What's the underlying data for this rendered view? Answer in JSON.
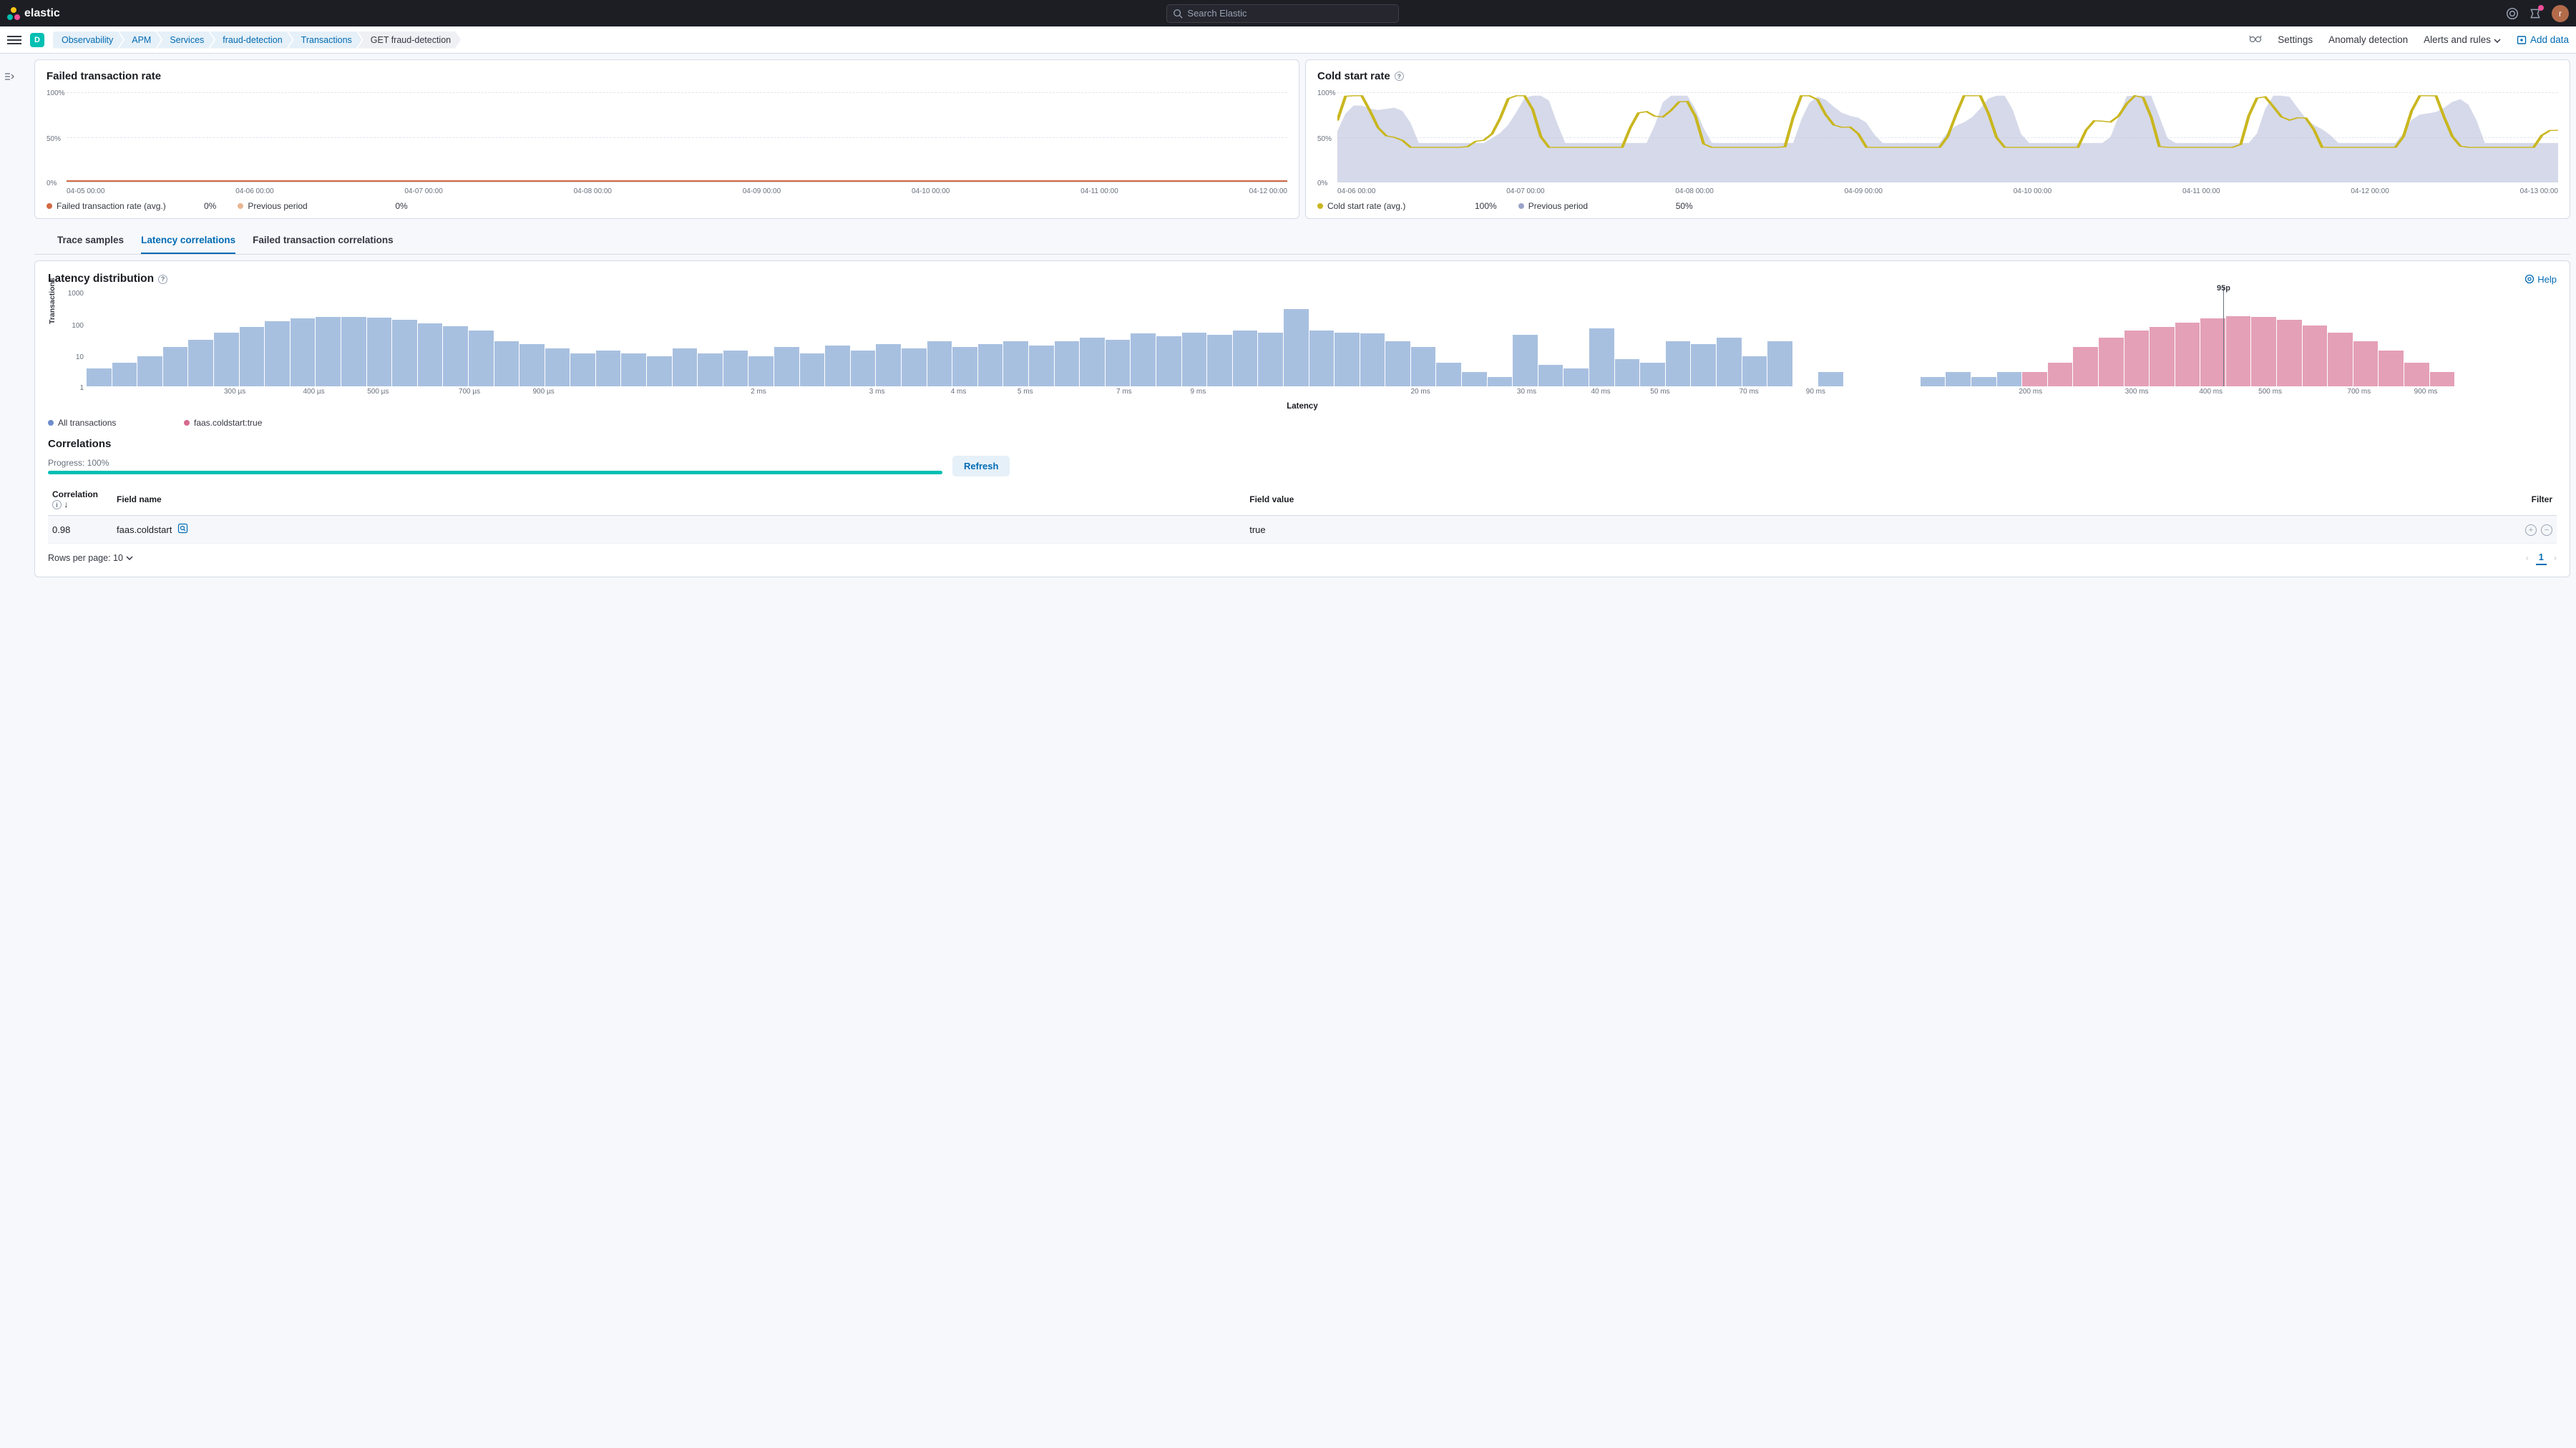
{
  "brand": "elastic",
  "search_placeholder": "Search Elastic",
  "space_letter": "D",
  "avatar_letter": "r",
  "breadcrumbs": [
    "Observability",
    "APM",
    "Services",
    "fraud-detection",
    "Transactions",
    "GET fraud-detection"
  ],
  "header_links": {
    "settings": "Settings",
    "anomaly": "Anomaly detection",
    "alerts": "Alerts and rules",
    "add": "Add data"
  },
  "panel_failed": {
    "title": "Failed transaction rate",
    "legend": [
      {
        "label": "Failed transaction rate (avg.)",
        "value": "0%",
        "color": "#d36a43"
      },
      {
        "label": "Previous period",
        "value": "0%",
        "color": "#e9b692"
      }
    ],
    "yticks": [
      "100%",
      "50%",
      "0%"
    ],
    "xticks": [
      "04-05 00:00",
      "04-06 00:00",
      "04-07 00:00",
      "04-08 00:00",
      "04-09 00:00",
      "04-10 00:00",
      "04-11 00:00",
      "04-12 00:00"
    ]
  },
  "panel_cold": {
    "title": "Cold start rate",
    "legend": [
      {
        "label": "Cold start rate (avg.)",
        "value": "100%",
        "color": "#c9b61f"
      },
      {
        "label": "Previous period",
        "value": "50%",
        "color": "#9aa3c9"
      }
    ],
    "yticks": [
      "100%",
      "50%",
      "0%"
    ],
    "xticks": [
      "04-06 00:00",
      "04-07 00:00",
      "04-08 00:00",
      "04-09 00:00",
      "04-10 00:00",
      "04-11 00:00",
      "04-12 00:00",
      "04-13 00:00"
    ]
  },
  "tabs": [
    "Trace samples",
    "Latency correlations",
    "Failed transaction correlations"
  ],
  "active_tab": 1,
  "latency": {
    "title": "Latency distribution",
    "help": "Help",
    "ylabel": "Transactions",
    "xlabel": "Latency",
    "ylabs": [
      "1000",
      "100",
      "10",
      "1"
    ],
    "p95_label": "95p",
    "p95_pos": 86.5,
    "xticks": [
      {
        "l": "300 µs",
        "p": 6
      },
      {
        "l": "400 µs",
        "p": 9.2
      },
      {
        "l": "500 µs",
        "p": 11.8
      },
      {
        "l": "700 µs",
        "p": 15.5
      },
      {
        "l": "900 µs",
        "p": 18.5
      },
      {
        "l": "2 ms",
        "p": 27.2
      },
      {
        "l": "3 ms",
        "p": 32
      },
      {
        "l": "4 ms",
        "p": 35.3
      },
      {
        "l": "5 ms",
        "p": 38
      },
      {
        "l": "7 ms",
        "p": 42
      },
      {
        "l": "9 ms",
        "p": 45
      },
      {
        "l": "20 ms",
        "p": 54
      },
      {
        "l": "30 ms",
        "p": 58.3
      },
      {
        "l": "40 ms",
        "p": 61.3
      },
      {
        "l": "50 ms",
        "p": 63.7
      },
      {
        "l": "70 ms",
        "p": 67.3
      },
      {
        "l": "90 ms",
        "p": 70
      },
      {
        "l": "200 ms",
        "p": 78.7
      },
      {
        "l": "300 ms",
        "p": 83
      },
      {
        "l": "400 ms",
        "p": 86
      },
      {
        "l": "500 ms",
        "p": 88.4
      },
      {
        "l": "700 ms",
        "p": 92
      },
      {
        "l": "900 ms",
        "p": 94.7
      }
    ],
    "legend": [
      {
        "label": "All transactions",
        "color": "#6d8cde"
      },
      {
        "label": "faas.coldstart:true",
        "color": "#d66a8d"
      }
    ]
  },
  "correlations": {
    "title": "Correlations",
    "progress_label": "Progress: 100%",
    "refresh": "Refresh",
    "cols": {
      "corr": "Correlation",
      "field": "Field name",
      "val": "Field value",
      "filter": "Filter"
    },
    "rows": [
      {
        "corr": "0.98",
        "field": "faas.coldstart",
        "value": "true"
      }
    ],
    "rows_per_page": "Rows per page: 10",
    "page": "1"
  },
  "chart_data": [
    {
      "type": "line",
      "title": "Failed transaction rate",
      "ylim": [
        0,
        100
      ],
      "x": [
        "04-05",
        "04-06",
        "04-07",
        "04-08",
        "04-09",
        "04-10",
        "04-11",
        "04-12"
      ],
      "series": [
        {
          "name": "Failed transaction rate (avg.)",
          "values": [
            0,
            0,
            0,
            0,
            0,
            0,
            0,
            0
          ]
        },
        {
          "name": "Previous period",
          "values": [
            0,
            0,
            0,
            0,
            0,
            0,
            0,
            0
          ]
        }
      ]
    },
    {
      "type": "area",
      "title": "Cold start rate",
      "ylim": [
        0,
        100
      ],
      "x": [
        "04-06",
        "04-07",
        "04-08",
        "04-09",
        "04-10",
        "04-11",
        "04-12",
        "04-13"
      ],
      "series": [
        {
          "name": "Cold start rate (avg.)",
          "note": "oscillating approx 20–100"
        },
        {
          "name": "Previous period",
          "note": "oscillating approx 10–100"
        }
      ]
    },
    {
      "type": "bar",
      "title": "Latency distribution",
      "ylabel": "Transactions",
      "xlabel": "Latency",
      "yscale": "log",
      "ylim": [
        1,
        1000
      ],
      "annotation": "95p",
      "series": [
        {
          "name": "All transactions",
          "values": [
            4,
            6,
            10,
            20,
            35,
            60,
            90,
            140,
            180,
            200,
            200,
            190,
            160,
            120,
            95,
            70,
            30,
            25,
            18,
            12,
            15,
            12,
            10,
            18,
            12,
            15,
            10,
            20,
            12,
            22,
            15,
            25,
            18,
            30,
            20,
            25,
            30,
            22,
            30,
            40,
            35,
            55,
            45,
            60,
            50,
            70,
            60,
            350,
            70,
            60,
            55,
            30,
            20,
            6,
            3,
            2,
            50,
            5,
            4,
            80,
            8,
            6,
            30,
            25,
            40,
            10,
            30,
            0,
            3,
            0,
            0,
            0,
            2,
            3,
            2,
            3
          ]
        },
        {
          "name": "faas.coldstart:true",
          "values_offset": 76,
          "values": [
            3,
            6,
            20,
            40,
            70,
            90,
            130,
            180,
            210,
            200,
            160,
            100,
            60,
            30,
            15,
            6,
            3
          ]
        }
      ]
    }
  ]
}
